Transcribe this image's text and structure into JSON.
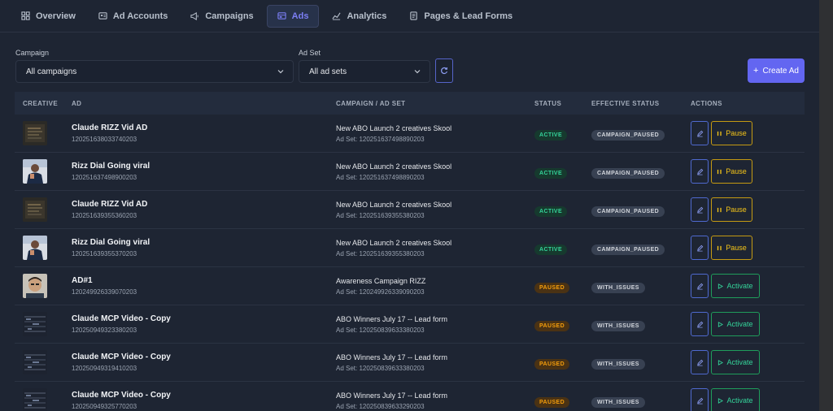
{
  "tabs": [
    {
      "label": "Overview",
      "icon": "overview-icon"
    },
    {
      "label": "Ad Accounts",
      "icon": "ad-accounts-icon"
    },
    {
      "label": "Campaigns",
      "icon": "megaphone-icon"
    },
    {
      "label": "Ads",
      "icon": "ads-icon",
      "active": true
    },
    {
      "label": "Analytics",
      "icon": "chart-icon"
    },
    {
      "label": "Pages & Lead Forms",
      "icon": "pages-icon"
    }
  ],
  "filters": {
    "campaign_label": "Campaign",
    "campaign_value": "All campaigns",
    "adset_label": "Ad Set",
    "adset_value": "All ad sets"
  },
  "create_label": "Create Ad",
  "columns": {
    "creative": "CREATIVE",
    "ad": "AD",
    "campaign": "CAMPAIGN / AD SET",
    "status": "STATUS",
    "effective": "EFFECTIVE STATUS",
    "actions": "ACTIONS"
  },
  "rows": [
    {
      "thumb": "dark",
      "name": "Claude RIZZ Vid AD",
      "id": "120251638033740203",
      "campaign": "New ABO Launch 2 creatives Skool",
      "adset": "Ad Set: 120251637498890203",
      "status": "ACTIVE",
      "effective": "CAMPAIGN_PAUSED",
      "action": "Pause"
    },
    {
      "thumb": "person",
      "name": "Rizz Dial Going viral",
      "id": "120251637498900203",
      "campaign": "New ABO Launch 2 creatives Skool",
      "adset": "Ad Set: 120251637498890203",
      "status": "ACTIVE",
      "effective": "CAMPAIGN_PAUSED",
      "action": "Pause"
    },
    {
      "thumb": "dark",
      "name": "Claude RIZZ Vid AD",
      "id": "120251639355360203",
      "campaign": "New ABO Launch 2 creatives Skool",
      "adset": "Ad Set: 120251639355380203",
      "status": "ACTIVE",
      "effective": "CAMPAIGN_PAUSED",
      "action": "Pause"
    },
    {
      "thumb": "person",
      "name": "Rizz Dial Going viral",
      "id": "120251639355370203",
      "campaign": "New ABO Launch 2 creatives Skool",
      "adset": "Ad Set: 120251639355380203",
      "status": "ACTIVE",
      "effective": "CAMPAIGN_PAUSED",
      "action": "Pause"
    },
    {
      "thumb": "face",
      "name": "AD#1",
      "id": "120249926339070203",
      "campaign": "Awareness Campaign RIZZ",
      "adset": "Ad Set: 120249926339090203",
      "status": "PAUSED",
      "effective": "WITH_ISSUES",
      "action": "Activate"
    },
    {
      "thumb": "grid",
      "name": "Claude MCP Video - Copy",
      "id": "120250949323380203",
      "campaign": "ABO Winners July 17 -- Lead form",
      "adset": "Ad Set: 120250839633380203",
      "status": "PAUSED",
      "effective": "WITH_ISSUES",
      "action": "Activate"
    },
    {
      "thumb": "grid",
      "name": "Claude MCP Video - Copy",
      "id": "120250949319410203",
      "campaign": "ABO Winners July 17 -- Lead form",
      "adset": "Ad Set: 120250839633380203",
      "status": "PAUSED",
      "effective": "WITH_ISSUES",
      "action": "Activate"
    },
    {
      "thumb": "grid",
      "name": "Claude MCP Video - Copy",
      "id": "120250949325770203",
      "campaign": "ABO Winners July 17 -- Lead form",
      "adset": "Ad Set: 120250839633290203",
      "status": "PAUSED",
      "effective": "WITH_ISSUES",
      "action": "Activate"
    }
  ]
}
